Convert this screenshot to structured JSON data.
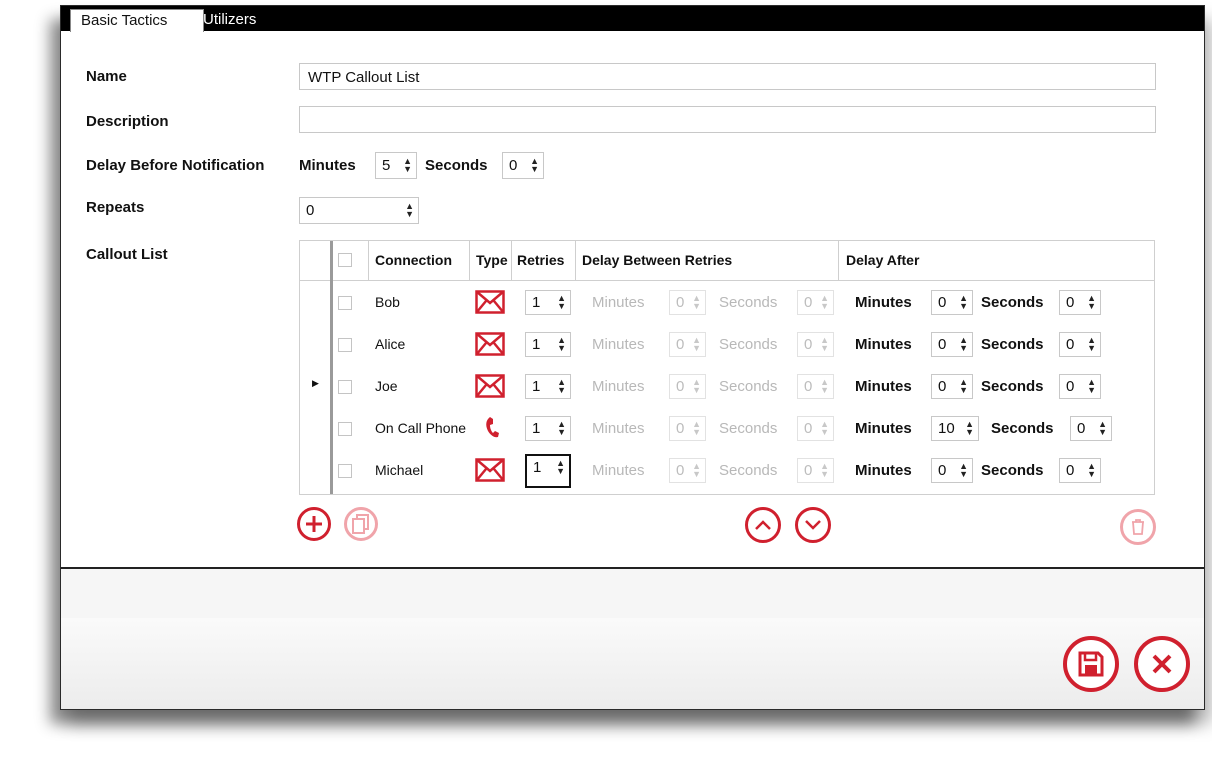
{
  "tabs": [
    {
      "label": "Basic Tactics"
    },
    {
      "label": "Utilizers"
    }
  ],
  "form": {
    "name_label": "Name",
    "name_value": "WTP Callout List",
    "description_label": "Description",
    "description_value": "",
    "delay_label": "Delay Before Notification",
    "delay_minutes_label": "Minutes",
    "delay_minutes_value": "5",
    "delay_seconds_label": "Seconds",
    "delay_seconds_value": "0",
    "repeats_label": "Repeats",
    "repeats_value": "0",
    "callout_label": "Callout List"
  },
  "grid": {
    "columns": {
      "connection": "Connection",
      "type": "Type",
      "retries": "Retries",
      "delay_between": "Delay Between Retries",
      "delay_after": "Delay After"
    },
    "minutes_label": "Minutes",
    "seconds_label": "Seconds",
    "rows": [
      {
        "name": "Bob",
        "type": "email",
        "retries": "1",
        "dbr_min": "0",
        "dbr_sec": "0",
        "da_min": "0",
        "da_sec": "0",
        "current": false
      },
      {
        "name": "Alice",
        "type": "email",
        "retries": "1",
        "dbr_min": "0",
        "dbr_sec": "0",
        "da_min": "0",
        "da_sec": "0",
        "current": false
      },
      {
        "name": "Joe",
        "type": "email",
        "retries": "1",
        "dbr_min": "0",
        "dbr_sec": "0",
        "da_min": "0",
        "da_sec": "0",
        "current": true
      },
      {
        "name": "On Call Phone",
        "type": "phone",
        "retries": "1",
        "dbr_min": "0",
        "dbr_sec": "0",
        "da_min": "10",
        "da_sec": "0",
        "current": false
      },
      {
        "name": "Michael",
        "type": "email",
        "retries": "1",
        "dbr_min": "0",
        "dbr_sec": "0",
        "da_min": "0",
        "da_sec": "0",
        "current": false
      }
    ]
  },
  "icons": {
    "add": "plus-circle-icon",
    "copy": "copy-icon",
    "move_up": "chevron-up-icon",
    "move_down": "chevron-down-icon",
    "delete": "trash-icon",
    "save": "save-icon",
    "cancel": "close-icon",
    "email": "envelope-icon",
    "phone": "phone-icon",
    "row_pointer": "row-pointer-icon"
  },
  "colors": {
    "accent": "#d0202e",
    "accent_disabled": "#f0a4aa"
  }
}
